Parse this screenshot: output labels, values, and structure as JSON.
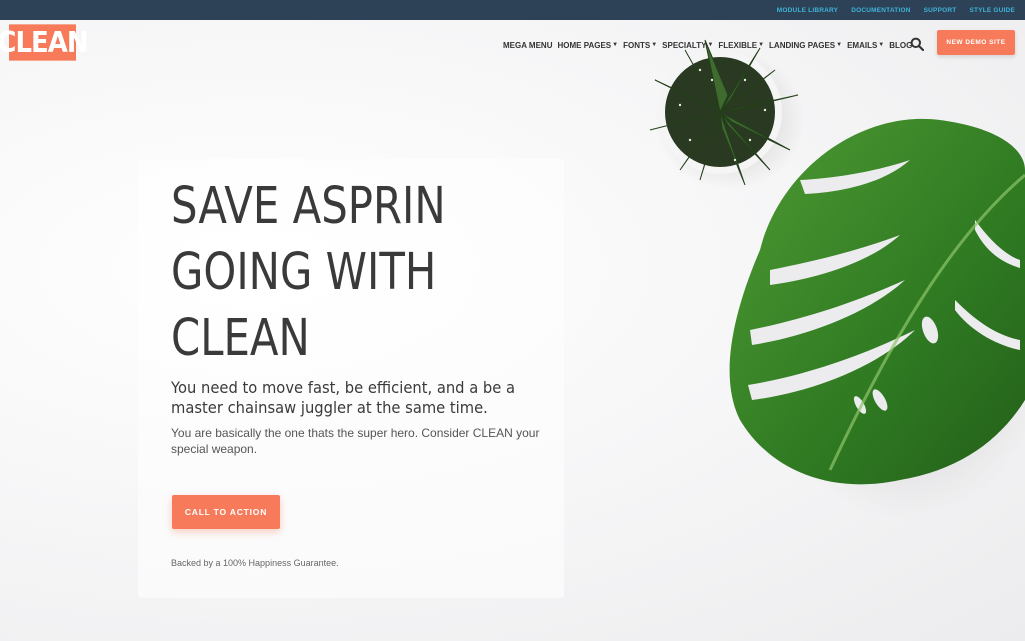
{
  "topbar": {
    "links": [
      "MODULE LIBRARY",
      "DOCUMENTATION",
      "SUPPORT",
      "STYLE GUIDE"
    ]
  },
  "header": {
    "logo_text": "CLEAN",
    "nav": [
      {
        "label": "MEGA MENU",
        "dropdown": false
      },
      {
        "label": "HOME PAGES",
        "dropdown": true
      },
      {
        "label": "FONTS",
        "dropdown": true
      },
      {
        "label": "SPECIALTY",
        "dropdown": true
      },
      {
        "label": "FLEXIBLE",
        "dropdown": true
      },
      {
        "label": "LANDING PAGES",
        "dropdown": true
      },
      {
        "label": "EMAILS",
        "dropdown": true
      },
      {
        "label": "BLOG",
        "dropdown": false
      }
    ],
    "search_icon": "search-icon",
    "demo_button": "NEW DEMO SITE"
  },
  "hero": {
    "headline": "SAVE ASPRIN\nGOING WITH\nCLEAN",
    "subhead": "You need to move fast, be efficient, and a be a master chainsaw juggler at the same time.",
    "body": "You are basically the one thats the super hero. Consider CLEAN your special weapon.",
    "cta": "CALL TO ACTION",
    "guarantee": "Backed by a 100% Happiness Guarantee."
  },
  "colors": {
    "accent": "#f77b5a",
    "topbar_bg": "#2e4257",
    "topbar_link": "#3fb3d8",
    "leaf_green": "#3f8a2a"
  }
}
